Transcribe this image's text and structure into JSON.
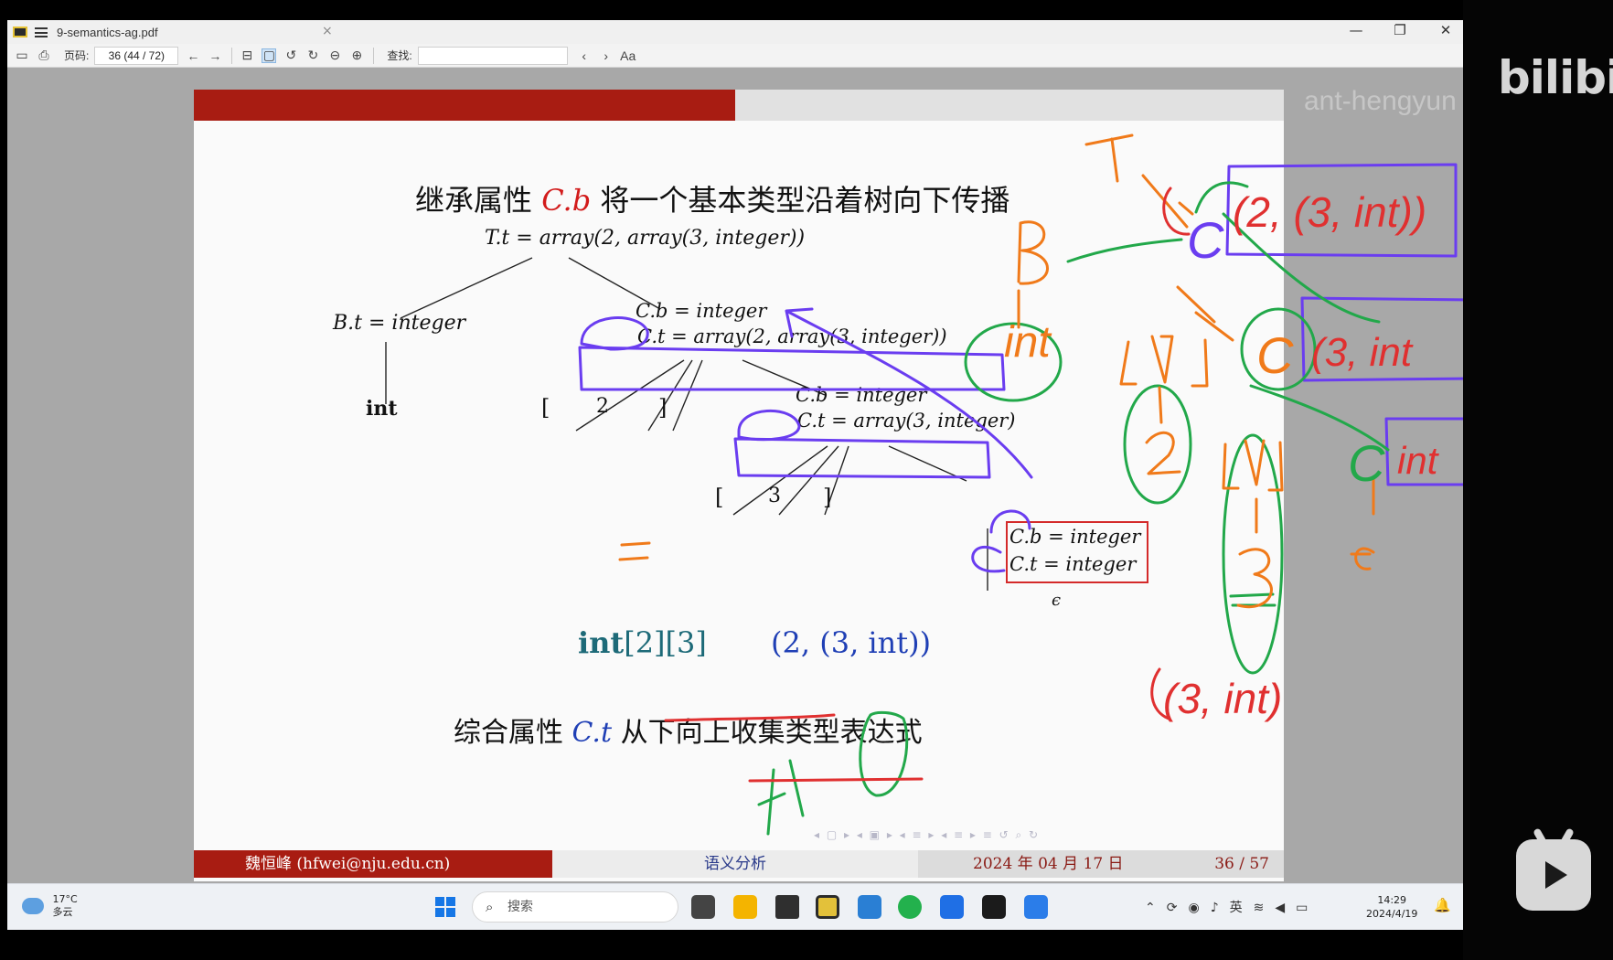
{
  "window": {
    "tab_title": "9-semantics-ag.pdf",
    "tab_close": "×",
    "minimize": "—",
    "restore": "❐",
    "close": "✕"
  },
  "toolbar": {
    "page_label": "页码:",
    "page_value": "36 (44 / 72)",
    "find_label": "查找:",
    "find_value": "",
    "case_toggle": "Aa"
  },
  "slide": {
    "heading_prefix": "继承属性",
    "heading_var": "C.b",
    "heading_suffix": "将一个基本类型沿着树向下传播",
    "root": "T.t = array(2, array(3, integer))",
    "b_node": "B.t = integer",
    "int_leaf": "int",
    "c1_b": "C.b = integer",
    "c1_t": "C.t = array(2, array(3, integer))",
    "lbr1": "[",
    "num2": "2",
    "rbr1": "]",
    "c2_b": "C.b = integer",
    "c2_t": "C.t = array(3, integer)",
    "lbr2": "[",
    "num3": "3",
    "rbr2": "]",
    "c3_b": "C.b = integer",
    "c3_t": "C.t = integer",
    "epsilon": "ϵ",
    "expr_left_bold": "int",
    "expr_left_rest": "[2][3]",
    "expr_right": "(2, (3, int))",
    "bottom_prefix": "综合属性",
    "bottom_var": "C.t",
    "bottom_suffix": "从下向上收集类型表达式",
    "nav_icons": "◂ ▢ ▸  ◂ ▣ ▸  ◂ ≡ ▸  ◂ ≡ ▸   ≡   ↺ ⌕ ↻"
  },
  "footer": {
    "author": "魏恒峰 (hfwei@nju.edu.cn)",
    "title": "语义分析",
    "date": "2024 年 04 月 17 日",
    "page": "36 / 57"
  },
  "taskbar": {
    "weather_temp": "17°C",
    "weather_desc": "多云",
    "search_placeholder": "搜索",
    "tray_lang": "英",
    "time": "14:29",
    "date": "2024/4/19"
  },
  "overlay": {
    "bilibili": "bilibili",
    "watermark": "ant-hengyun"
  },
  "annotations": {
    "T": "T",
    "B": "B",
    "int": "int",
    "C": "C",
    "N1": "[N]",
    "two": "2",
    "N2": "[N]",
    "three": "3",
    "E": "E",
    "t1": "(2, (3, int))",
    "t2": "(3, int",
    "t3": "int",
    "t4": "(3, int)",
    "eq": "=",
    "under_note": "↑↑↑"
  },
  "colors": {
    "slide_red": "#a81c12",
    "math_red": "#d21b1b",
    "math_blue": "#1f3fb5",
    "ink_orange": "#f07a1a",
    "ink_green": "#22a84a",
    "ink_purple": "#6a3df0",
    "ink_red": "#e03030"
  }
}
